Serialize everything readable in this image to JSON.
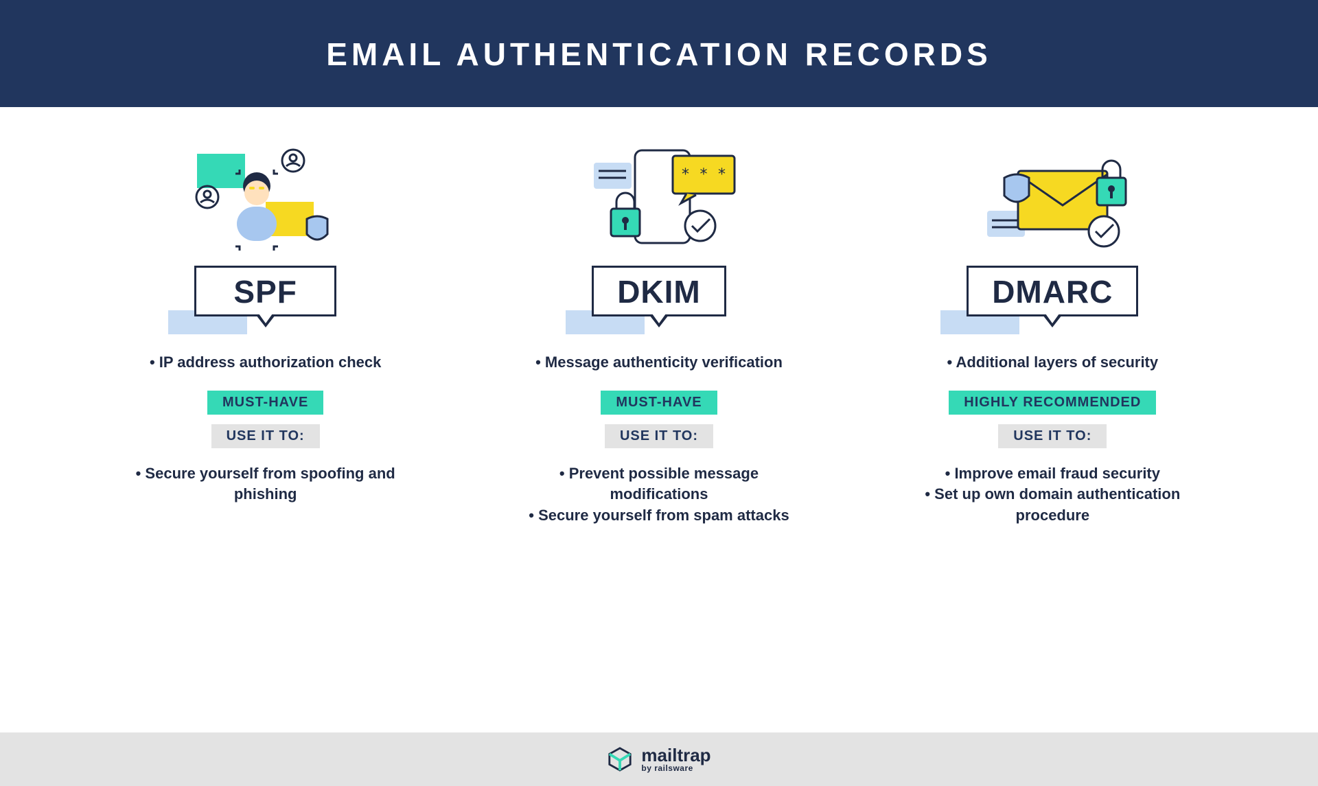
{
  "title": "EMAIL AUTHENTICATION RECORDS",
  "useLabel": "USE IT TO:",
  "columns": [
    {
      "name": "SPF",
      "desc": "• IP address authorization check",
      "tag": "MUST-HAVE",
      "uses": "• Secure yourself from spoofing and phishing"
    },
    {
      "name": "DKIM",
      "desc": "• Message authenticity verification",
      "tag": "MUST-HAVE",
      "uses": "• Prevent possible message modifications\n• Secure yourself from spam attacks"
    },
    {
      "name": "DMARC",
      "desc": "• Additional layers of security",
      "tag": "HIGHLY RECOMMENDED",
      "uses": "• Improve email fraud security\n• Set up own domain authentication procedure"
    }
  ],
  "brand": {
    "name": "mailtrap",
    "by": "by railsware"
  },
  "colors": {
    "navy": "#21365e",
    "teal": "#35d9b6",
    "blueLight": "#c7dcf4",
    "yellow": "#f6d922",
    "grey": "#e3e3e3"
  }
}
